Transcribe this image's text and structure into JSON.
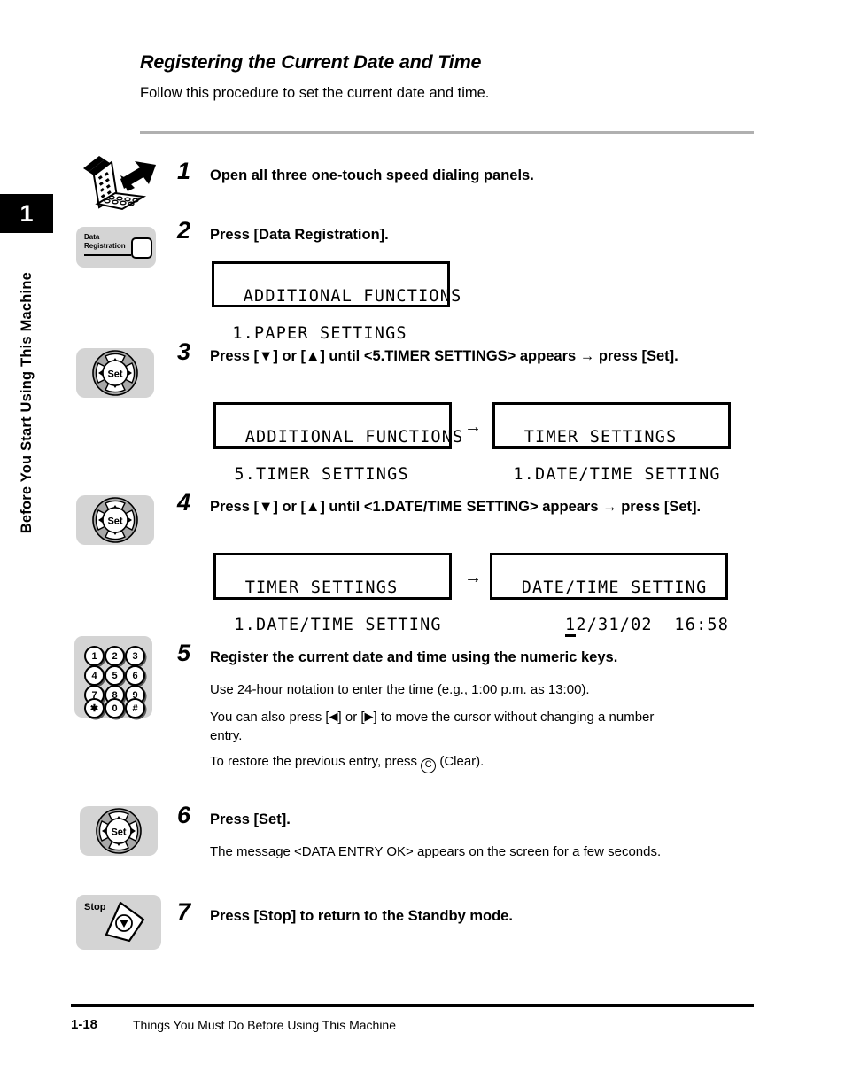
{
  "sidebar": {
    "chapter_number": "1",
    "chapter_label": "Before You Start Using This Machine"
  },
  "header": {
    "title": "Registering the Current Date and Time",
    "subtitle": "Follow this procedure to set the current date and time."
  },
  "steps": [
    {
      "number": "1",
      "heading": "Open all three one-touch speed dialing panels.",
      "icon": "one-touch-panels-icon"
    },
    {
      "number": "2",
      "heading": "Press [Data Registration].",
      "icon": "data-registration-key-icon",
      "icon_label_line1": "Data",
      "icon_label_line2": "Registration"
    },
    {
      "number": "3",
      "heading_line1": "Press [▼] or [▲] until <5.TIMER SETTINGS> appears → press",
      "heading_line2": "[Set].",
      "icon": "set-directional-pad-icon"
    },
    {
      "number": "4",
      "heading_line1": "Press [▼] or [▲] until <1.DATE/TIME SETTING> appears →",
      "heading_line2": "press [Set].",
      "icon": "set-directional-pad-icon"
    },
    {
      "number": "5",
      "heading": "Register the current date and time using the numeric keys.",
      "icon": "numeric-keypad-icon",
      "body1": "Use 24-hour notation to enter the time (e.g., 1:00 p.m. as 13:00).",
      "body2_pre": "You can also press [",
      "body2_mid": "] or [",
      "body2_post": "] to move the cursor without changing a number",
      "body2_line2": "entry.",
      "body3_pre": "To restore the previous entry, press ",
      "body3_c": "C",
      "body3_post": " (Clear)."
    },
    {
      "number": "6",
      "heading": "Press [Set].",
      "icon": "set-directional-pad-icon",
      "body1": "The message <DATA ENTRY OK> appears on the screen for a few seconds."
    },
    {
      "number": "7",
      "heading": "Press [Stop] to return to the Standby mode.",
      "icon": "stop-key-icon",
      "icon_label": "Stop"
    }
  ],
  "lcd_displays": {
    "step2": {
      "line1": "ADDITIONAL FUNCTIONS",
      "line2": " 1.PAPER SETTINGS"
    },
    "step3_left": {
      "line1": "ADDITIONAL FUNCTIONS",
      "line2": " 5.TIMER SETTINGS"
    },
    "step3_arrow": "→",
    "step3_right": {
      "line1": "TIMER SETTINGS",
      "line2": " 1.DATE/TIME SETTING"
    },
    "step4_left": {
      "line1": "TIMER SETTINGS",
      "line2": " 1.DATE/TIME SETTING"
    },
    "step4_arrow": "→",
    "step4_right": {
      "line1": "DATE/TIME SETTING",
      "line2_prefix": "      ",
      "line2_cursor": "1",
      "line2_rest": "2/31/02  16:58"
    }
  },
  "keypad_keys": [
    "1",
    "2",
    "3",
    "4",
    "5",
    "6",
    "7",
    "8",
    "9",
    "✱",
    "0",
    "#"
  ],
  "setpad": {
    "center_label": "Set"
  },
  "footer": {
    "page_number": "1-18",
    "text": "Things You Must Do Before Using This Machine"
  },
  "glyphs": {
    "left_triangle": "◀",
    "right_triangle": "▶"
  }
}
